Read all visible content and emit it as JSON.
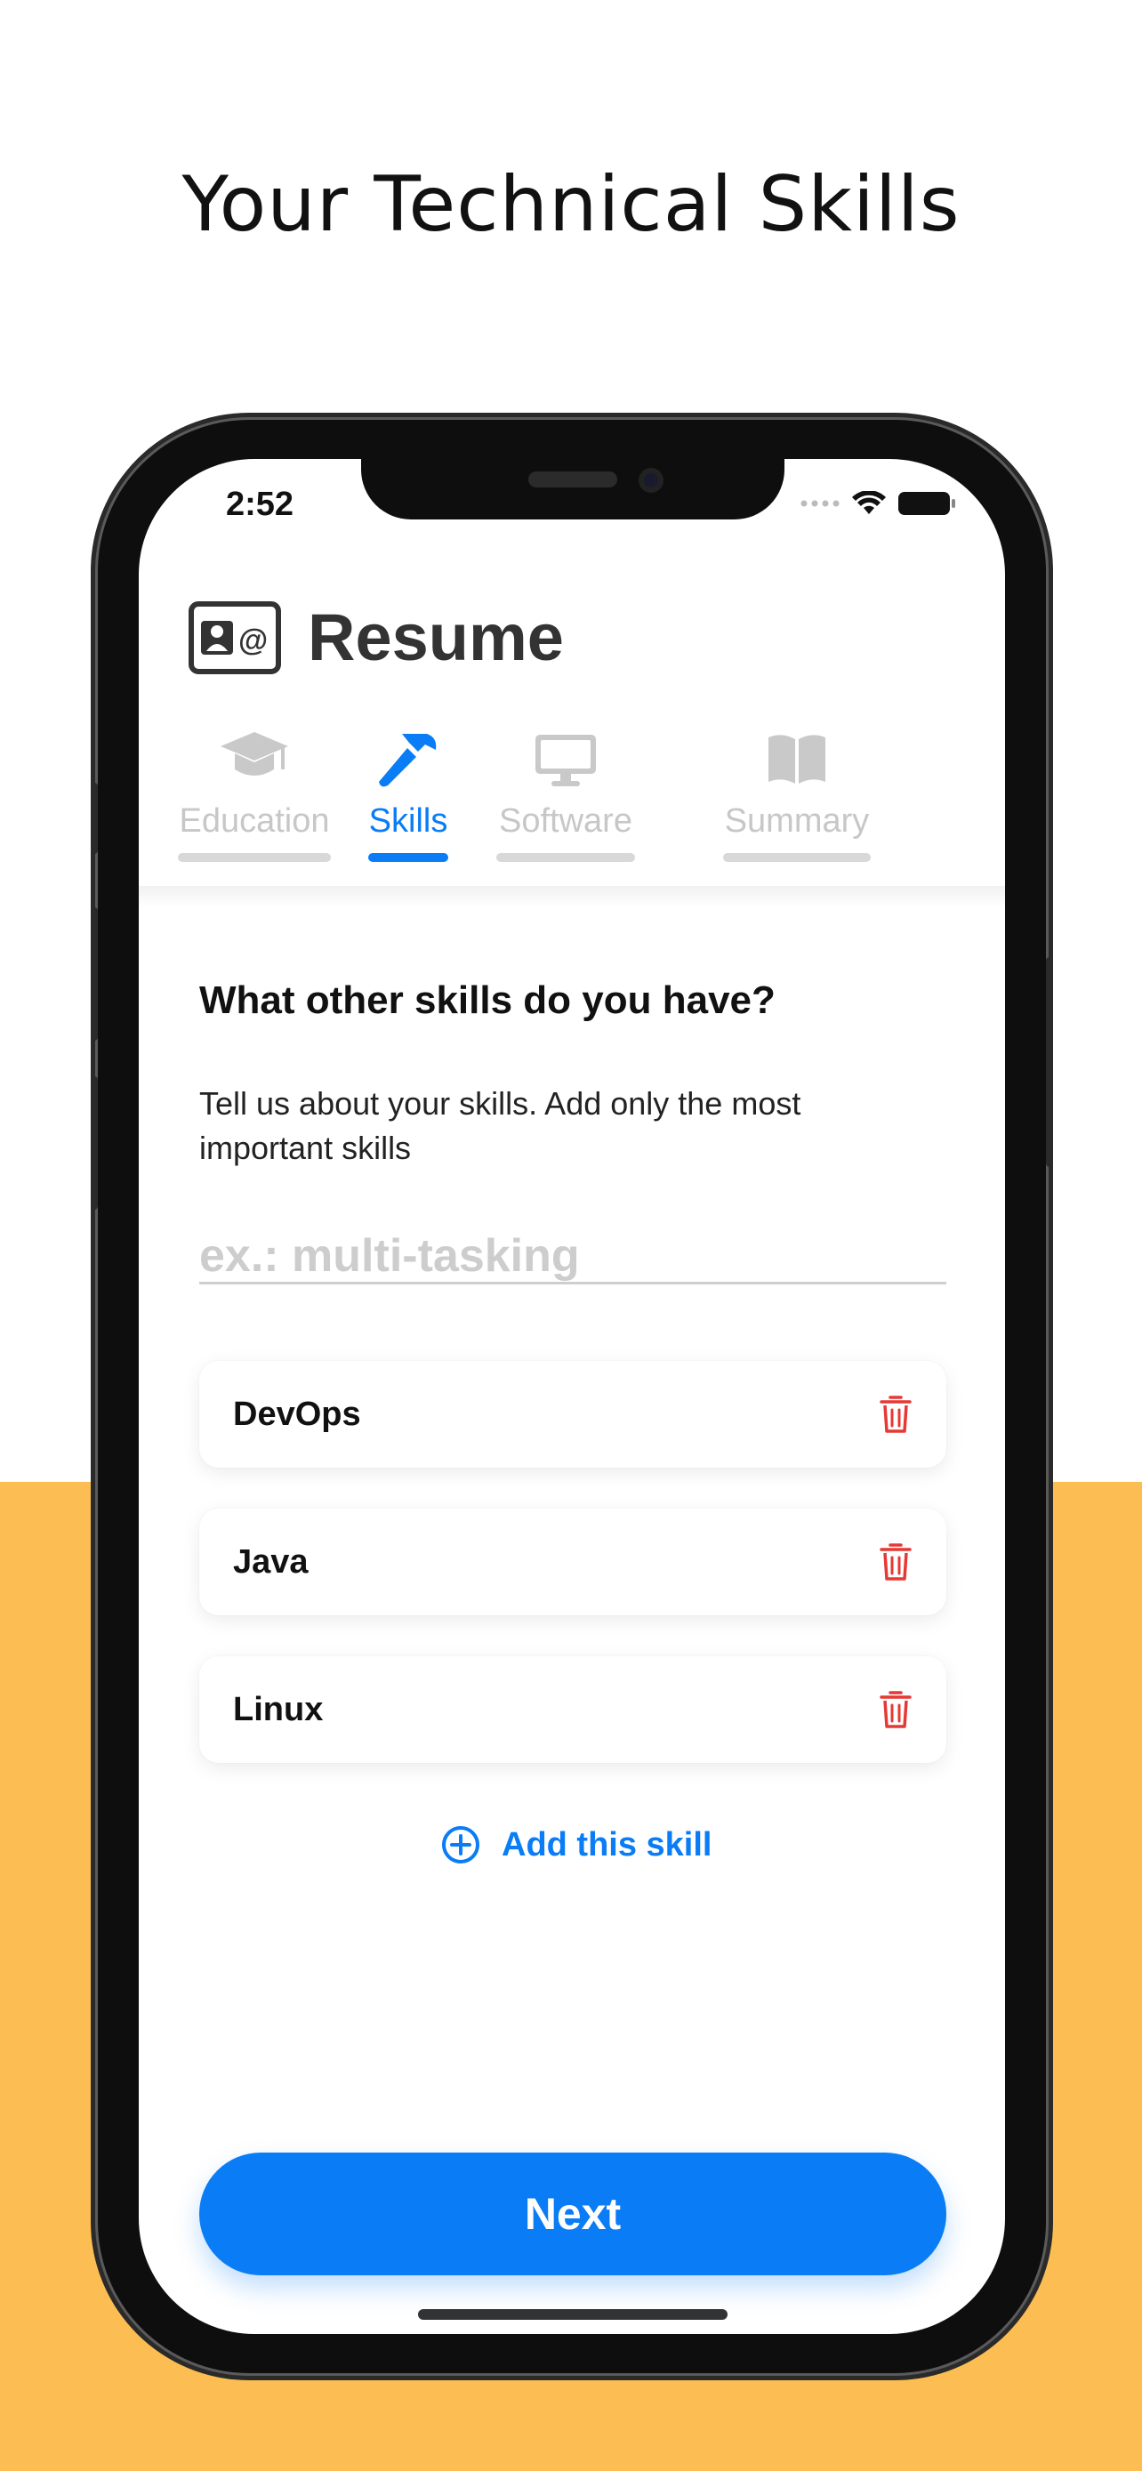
{
  "headline": "Your Technical Skills",
  "status_bar": {
    "time": "2:52"
  },
  "app": {
    "title": "Resume"
  },
  "tabs": [
    {
      "label": "Education",
      "icon": "graduation-cap-icon",
      "active": false
    },
    {
      "label": "Skills",
      "icon": "hammer-icon",
      "active": true
    },
    {
      "label": "Software",
      "icon": "desktop-icon",
      "active": false
    },
    {
      "label": "Summary",
      "icon": "book-icon",
      "active": false
    }
  ],
  "form": {
    "question": "What other skills do you have?",
    "description": "Tell us about your skills. Add only the most important skills",
    "input_placeholder": "ex.: multi-tasking",
    "input_value": ""
  },
  "skills": [
    {
      "name": "DevOps",
      "icon": "trash-icon"
    },
    {
      "name": "Java",
      "icon": "trash-icon"
    },
    {
      "name": "Linux",
      "icon": "trash-icon"
    }
  ],
  "add_skill_label": "Add this skill",
  "next_label": "Next",
  "colors": {
    "accent": "#0a7cf5",
    "delete": "#e53935",
    "background_band": "#FCBE52",
    "inactive_tab": "#c7c7c7"
  }
}
